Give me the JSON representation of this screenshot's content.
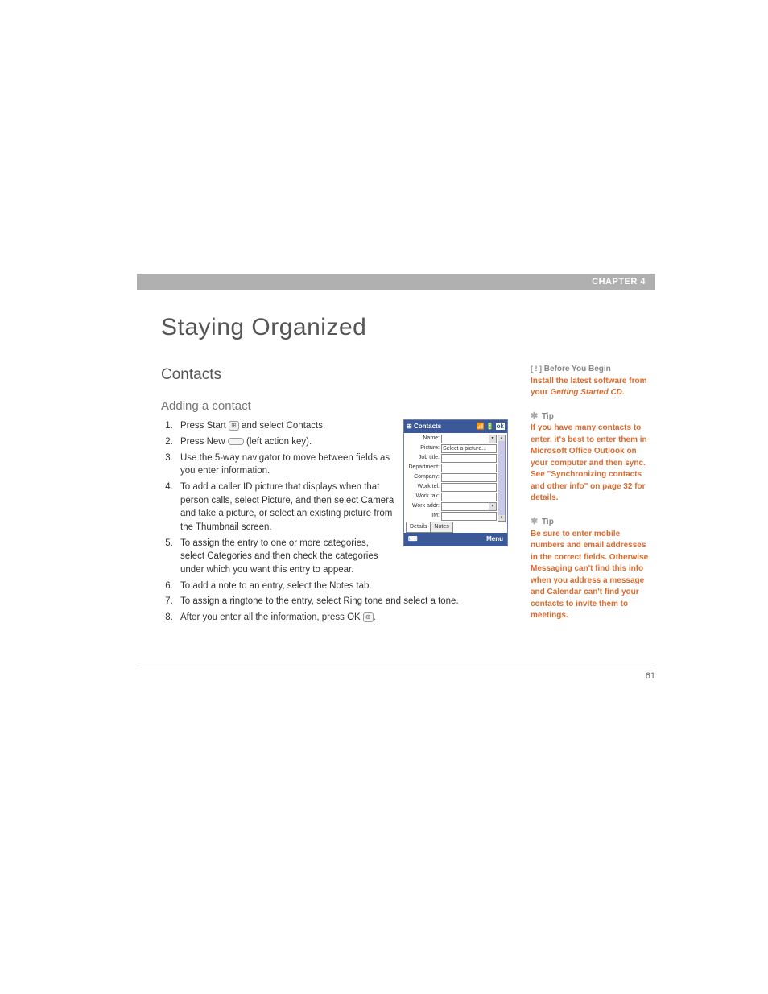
{
  "chapter": "CHAPTER 4",
  "title": "Staying Organized",
  "section": "Contacts",
  "subsection": "Adding a contact",
  "steps": [
    "Press Start ⊞ and select Contacts.",
    "Press New ⌐ (left action key).",
    "Use the 5-way navigator to move between fields as you enter information.",
    "To add a caller ID picture that displays when that person calls, select Picture, and then select Camera and take a picture, or select an existing picture from the Thumbnail screen.",
    "To assign the entry to one or more categories, select Categories and then check the categories under which you want this entry to appear.",
    "To add a note to an entry, select the Notes tab.",
    "To assign a ringtone to the entry, select Ring tone and select a tone.",
    "After you enter all the information, press OK ⊛."
  ],
  "sidebar": {
    "before_h": "Before You Begin",
    "before_body": "Install the latest software from your Getting Started CD.",
    "tip1_h": "Tip",
    "tip1_body": "If you have many contacts to enter, it's best to enter them in Microsoft Office Outlook on your computer and then sync. See \"Synchronizing contacts and other info\" on page 32 for details.",
    "tip2_h": "Tip",
    "tip2_body": "Be sure to enter mobile numbers and email addresses in the correct fields. Otherwise Messaging can't find this info when you address a message and Calendar can't find your contacts to invite them to meetings."
  },
  "screenshot": {
    "title": "Contacts",
    "fields": [
      "Name:",
      "Picture:",
      "Job title:",
      "Department:",
      "Company:",
      "Work tel:",
      "Work fax:",
      "Work addr:",
      "IM:"
    ],
    "picture_value": "Select a picture...",
    "tabs": [
      "Details",
      "Notes"
    ],
    "bottom_right": "Menu"
  },
  "page_num": "61"
}
